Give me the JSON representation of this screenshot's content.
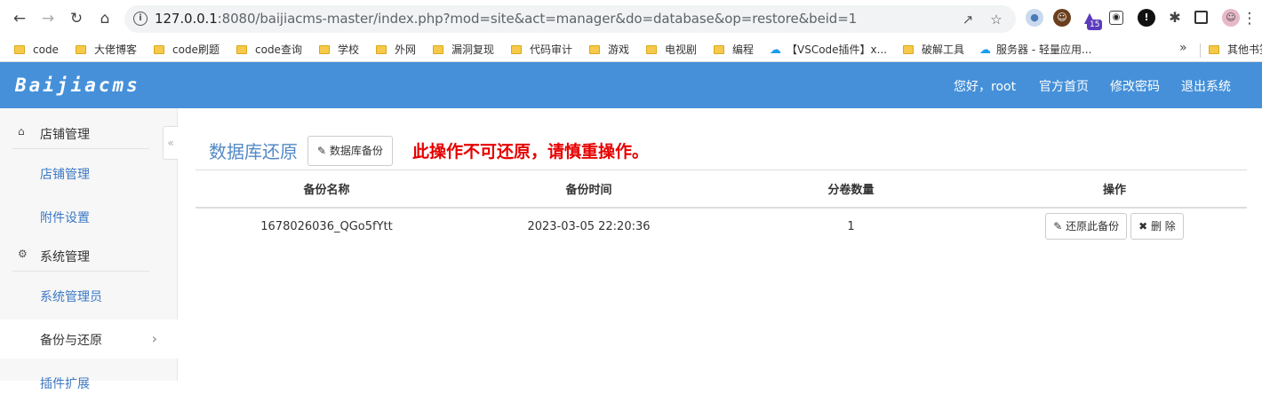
{
  "browser": {
    "url_host": "127.0.0.1",
    "url_rest": ":8080/baijiacms-master/index.php?mod=site&act=manager&do=database&op=restore&beid=1",
    "extension_badge": "15",
    "bookmarks": [
      {
        "label": "code",
        "kind": "folder"
      },
      {
        "label": "大佬博客",
        "kind": "folder"
      },
      {
        "label": "code刷题",
        "kind": "folder"
      },
      {
        "label": "code查询",
        "kind": "folder"
      },
      {
        "label": "学校",
        "kind": "folder"
      },
      {
        "label": "外网",
        "kind": "folder"
      },
      {
        "label": "漏洞复现",
        "kind": "folder"
      },
      {
        "label": "代码审计",
        "kind": "folder"
      },
      {
        "label": "游戏",
        "kind": "folder"
      },
      {
        "label": "电视剧",
        "kind": "folder"
      },
      {
        "label": "编程",
        "kind": "folder"
      },
      {
        "label": "【VSCode插件】x...",
        "kind": "cloud"
      },
      {
        "label": "破解工具",
        "kind": "folder"
      },
      {
        "label": "服务器 - 轻量应用...",
        "kind": "cloud"
      },
      {
        "label": "其他书签",
        "kind": "folder"
      }
    ],
    "more_label": "»"
  },
  "header": {
    "logo": "Baijiacms",
    "greeting": "您好，root",
    "links": [
      "官方首页",
      "修改密码",
      "退出系统"
    ],
    "color": "#4590d9"
  },
  "sidebar": {
    "groups": [
      {
        "label": "店铺管理",
        "icon": "home-icon",
        "items": [
          "店铺管理",
          "附件设置"
        ]
      },
      {
        "label": "系统管理",
        "icon": "gears-icon",
        "items": [
          "系统管理员",
          "备份与还原",
          "插件扩展"
        ]
      }
    ],
    "active_item": "备份与还原"
  },
  "main": {
    "title": "数据库还原",
    "backup_button": "数据库备份",
    "warning": "此操作不可还原，请慎重操作。",
    "warning_color": "#e60000",
    "table": {
      "headers": [
        "备份名称",
        "备份时间",
        "分卷数量",
        "操作"
      ],
      "rows": [
        {
          "name": "1678026036_QGo5fYtt",
          "time": "2023-03-05 22:20:36",
          "volumes": "1",
          "restore_label": "还原此备份",
          "delete_label": "删 除"
        }
      ]
    }
  }
}
